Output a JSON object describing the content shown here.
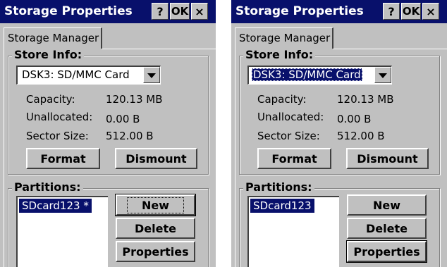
{
  "windows": [
    {
      "title": "Storage Properties",
      "help_label": "?",
      "ok_label": "OK",
      "close_label": "×",
      "tab_label": "Storage Manager",
      "store_info_legend": "Store Info:",
      "store_selected": "DSK3: SD/MMC Card",
      "capacity_label": "Capacity:",
      "capacity_value": "120.13 MB",
      "unallocated_label": "Unallocated:",
      "unallocated_value": "0.00 B",
      "sector_label": "Sector Size:",
      "sector_value": "512.00 B",
      "format_label": "Format",
      "dismount_label": "Dismount",
      "partitions_legend": "Partitions:",
      "partition_item": "SDcard123 *",
      "new_label": "New",
      "delete_label": "Delete",
      "properties_label": "Properties"
    },
    {
      "title": "Storage Properties",
      "help_label": "?",
      "ok_label": "OK",
      "close_label": "×",
      "tab_label": "Storage Manager",
      "store_info_legend": "Store Info:",
      "store_selected": "DSK3: SD/MMC Card",
      "capacity_label": "Capacity:",
      "capacity_value": "120.13 MB",
      "unallocated_label": "Unallocated:",
      "unallocated_value": "0.00 B",
      "sector_label": "Sector Size:",
      "sector_value": "512.00 B",
      "format_label": "Format",
      "dismount_label": "Dismount",
      "partitions_legend": "Partitions:",
      "partition_item": "SDcard123",
      "new_label": "New",
      "delete_label": "Delete",
      "properties_label": "Properties"
    }
  ]
}
